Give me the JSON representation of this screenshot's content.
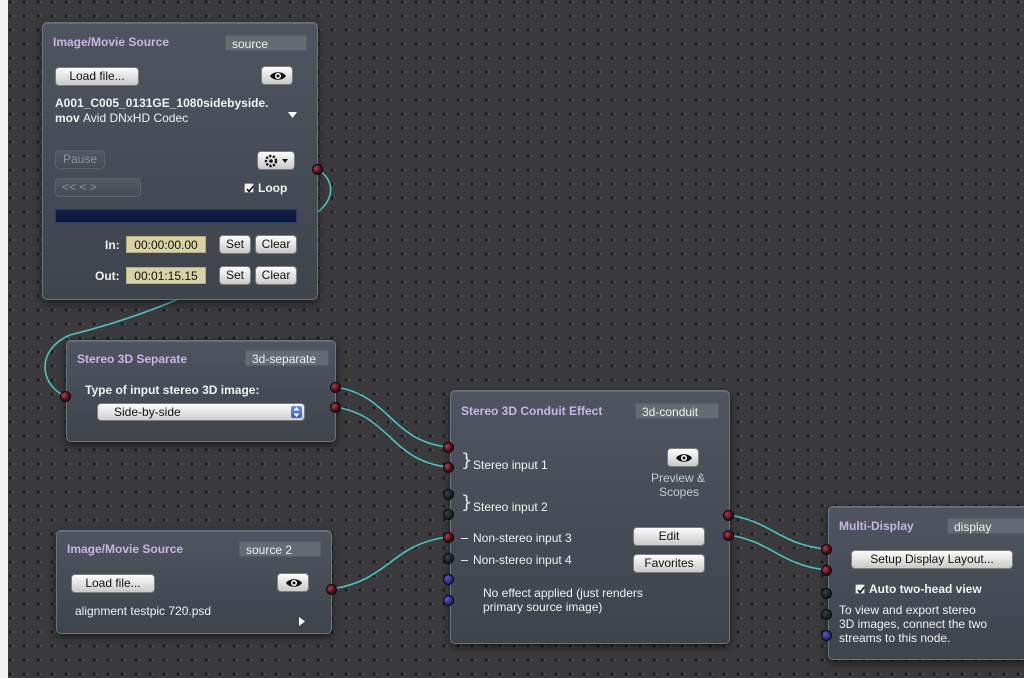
{
  "nodes": {
    "source1": {
      "title": "Image/Movie Source",
      "id": "source",
      "load_label": "Load file...",
      "filename": "A001_C005_0131GE_1080sidebyside.",
      "filename_ext": "mov",
      "codec": "Avid DNxHD Codec",
      "pause_label": "Pause",
      "nav_label": "<<   <    >",
      "loop_label": "Loop",
      "loop_checked": true,
      "in_label": "In:",
      "in_value": "00:00:00.00",
      "out_label": "Out:",
      "out_value": "00:01:15.15",
      "set_label": "Set",
      "clear_label": "Clear"
    },
    "separate": {
      "title": "Stereo 3D Separate",
      "id": "3d-separate",
      "type_label": "Type of input stereo 3D image:",
      "type_value": "Side-by-side"
    },
    "source2": {
      "title": "Image/Movie Source",
      "id": "source 2",
      "load_label": "Load file...",
      "filename": "alignment testpic 720.psd"
    },
    "conduit": {
      "title": "Stereo 3D Conduit Effect",
      "id": "3d-conduit",
      "inputs": [
        "Stereo input 1",
        "Stereo input 2",
        "Non-stereo input 3",
        "Non-stereo input 4"
      ],
      "preview_label_1": "Preview &",
      "preview_label_2": "Scopes",
      "edit_label": "Edit",
      "favorites_label": "Favorites",
      "status_1": "No effect applied (just renders",
      "status_2": "primary source image)"
    },
    "display": {
      "title": "Multi-Display",
      "id": "display",
      "setup_label": "Setup Display Layout...",
      "auto_label": "Auto two-head view",
      "auto_checked": true,
      "info_1": "To view and export stereo",
      "info_2": "3D images, connect the two",
      "info_3": "streams to this node."
    }
  },
  "colors": {
    "canvas": "#3a3a3c",
    "wire": "#4fc2c4",
    "node_title": "#c9b5e6",
    "timecode_bg": "#d9d2a5"
  },
  "icons": [
    "eye-icon",
    "gear-icon",
    "chevron-down-icon",
    "chevron-right-icon",
    "checkmark-icon",
    "stepper-icon",
    "brace-icon"
  ]
}
